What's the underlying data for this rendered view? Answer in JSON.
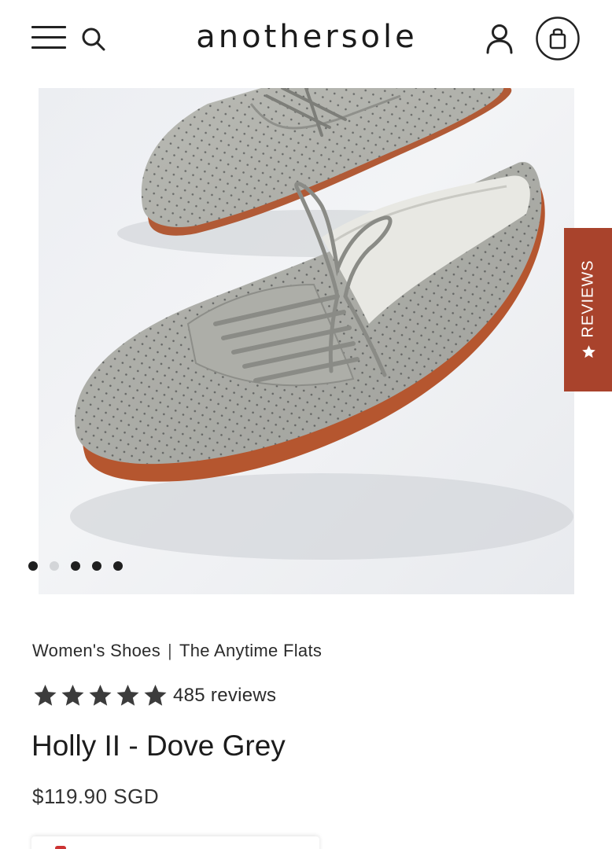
{
  "header": {
    "logo": "anothersole",
    "menu_icon": "hamburger-menu-icon",
    "search_icon": "search-icon",
    "account_icon": "user-account-icon",
    "cart_icon": "shopping-bag-icon"
  },
  "gallery": {
    "image_subject": "grey perforated lace-up leather flats",
    "dots_total": 5,
    "active_dot": 1
  },
  "reviews_tab": {
    "label": "REVIEWS",
    "icon": "star-icon",
    "color": "#a9432c"
  },
  "product": {
    "breadcrumb": [
      "Women's Shoes",
      "The Anytime Flats"
    ],
    "breadcrumb_separator": "|",
    "rating": 5,
    "review_count_label": "485 reviews",
    "title": "Holly II - Dove Grey",
    "price": "$119.90 SGD"
  }
}
